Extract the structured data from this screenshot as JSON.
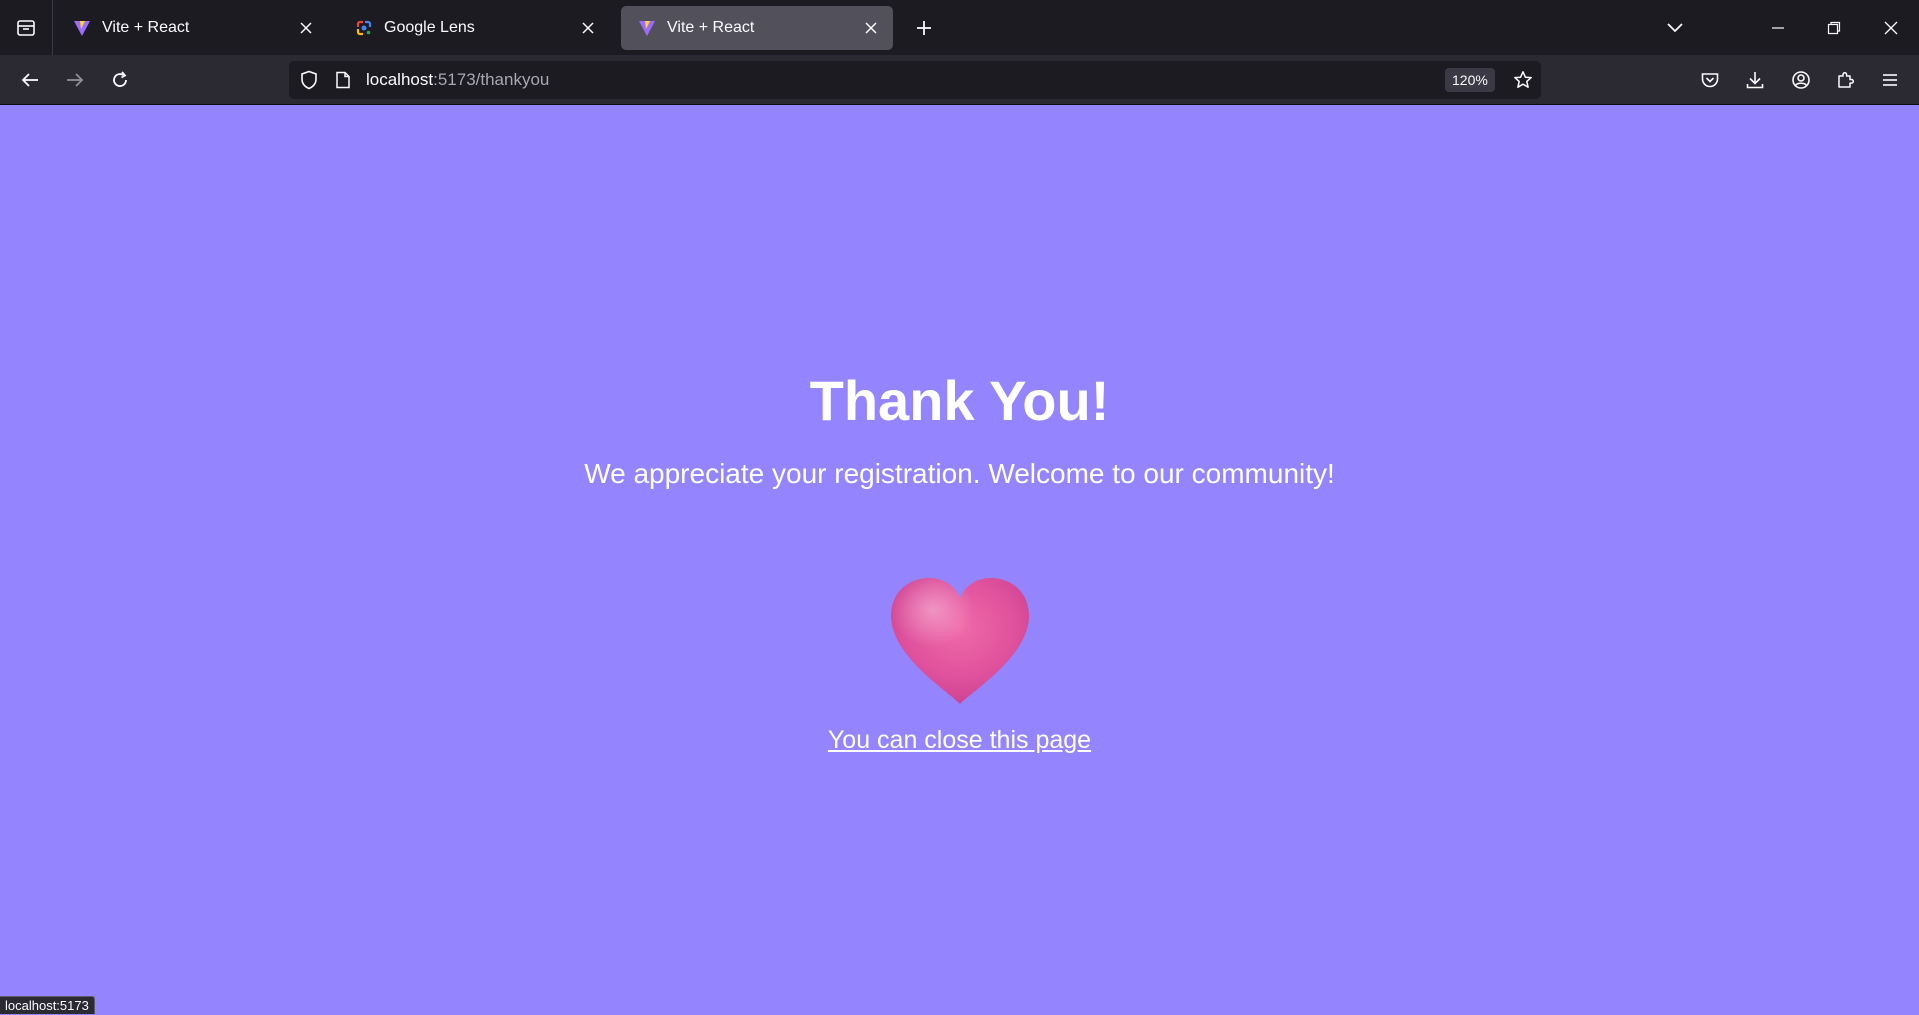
{
  "browser": {
    "tabs": [
      {
        "title": "Vite + React",
        "favicon": "vite-icon",
        "active": false
      },
      {
        "title": "Google Lens",
        "favicon": "google-lens-icon",
        "active": false
      },
      {
        "title": "Vite + React",
        "favicon": "vite-icon",
        "active": true
      }
    ],
    "url": {
      "host": "localhost",
      "path": ":5173/thankyou"
    },
    "zoom": "120%",
    "status_text": "localhost:5173"
  },
  "page": {
    "heading": "Thank You!",
    "subtitle": "We appreciate your registration. Welcome to our community!",
    "close_link": "You can close this page",
    "heart_icon": "heart-icon"
  },
  "colors": {
    "page_background": "#9484fe",
    "tabstrip_background": "#1c1b22",
    "navbar_background": "#2b2a33",
    "heart_pink": "#e3559f"
  }
}
